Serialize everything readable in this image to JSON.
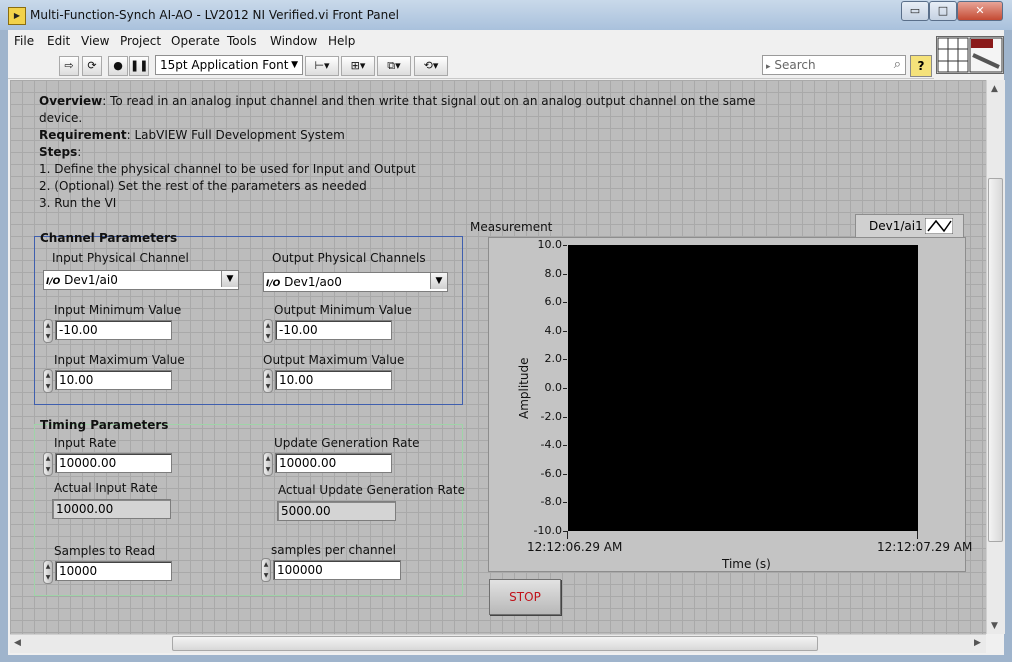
{
  "window": {
    "title": "Multi-Function-Synch AI-AO - LV2012 NI Verified.vi Front Panel",
    "minimize_label": "▭",
    "maximize_label": "□",
    "close_label": "✕"
  },
  "menu": [
    "File",
    "Edit",
    "View",
    "Project",
    "Operate",
    "Tools",
    "Window",
    "Help"
  ],
  "toolbar": {
    "font_select": "15pt Application Font",
    "search_placeholder": "Search"
  },
  "description": {
    "overview_label": "Overview",
    "overview_text": ": To read in an analog input channel and then write that signal out on an analog output channel on the same",
    "overview_text_2": "device.",
    "requirement_label": "Requirement",
    "requirement_text": ": LabVIEW Full Development System",
    "steps_label": "Steps",
    "steps_colon": ":",
    "steps": [
      "1. Define the physical channel to be used for Input and Output",
      "2. (Optional) Set the rest of the parameters as needed",
      "3. Run the VI"
    ]
  },
  "channel_params": {
    "title": "Channel Parameters",
    "input_channel_label": "Input Physical Channel",
    "input_channel_value": "Dev1/ai0",
    "output_channel_label": "Output Physical Channels",
    "output_channel_value": "Dev1/ao0",
    "input_min_label": "Input Minimum Value",
    "input_min_value": "-10.00",
    "output_min_label": "Output Minimum Value",
    "output_min_value": "-10.00",
    "input_max_label": "Input Maximum Value",
    "input_max_value": "10.00",
    "output_max_label": "Output Maximum Value",
    "output_max_value": "10.00"
  },
  "timing_params": {
    "title": "Timing Parameters",
    "input_rate_label": "Input Rate",
    "input_rate_value": "10000.00",
    "update_rate_label": "Update Generation Rate",
    "update_rate_value": "10000.00",
    "actual_input_rate_label": "Actual Input Rate",
    "actual_input_rate_value": "10000.00",
    "actual_update_rate_label": "Actual Update Generation Rate",
    "actual_update_rate_value": "5000.00",
    "samples_to_read_label": "Samples to Read",
    "samples_to_read_value": "10000",
    "samples_per_channel_label": "samples per channel",
    "samples_per_channel_value": "100000"
  },
  "graph": {
    "label": "Measurement",
    "legend_label": "Dev1/ai1",
    "y_axis_label": "Amplitude",
    "x_axis_label": "Time (s)",
    "y_ticks": [
      "10.0",
      "8.0",
      "6.0",
      "4.0",
      "2.0",
      "0.0",
      "-2.0",
      "-4.0",
      "-6.0",
      "-8.0",
      "-10.0"
    ],
    "x_start": "12:12:06.29 AM",
    "x_end": "12:12:07.29 AM",
    "ylim": [
      -10,
      10
    ],
    "plot_color": "#000000"
  },
  "stop_label": "STOP",
  "colors": {
    "stop_text": "#c0121a",
    "channel_group_border": "#3f5fae",
    "timing_group_border": "#9fd4a8",
    "panel_background": "#bcbcbc"
  }
}
